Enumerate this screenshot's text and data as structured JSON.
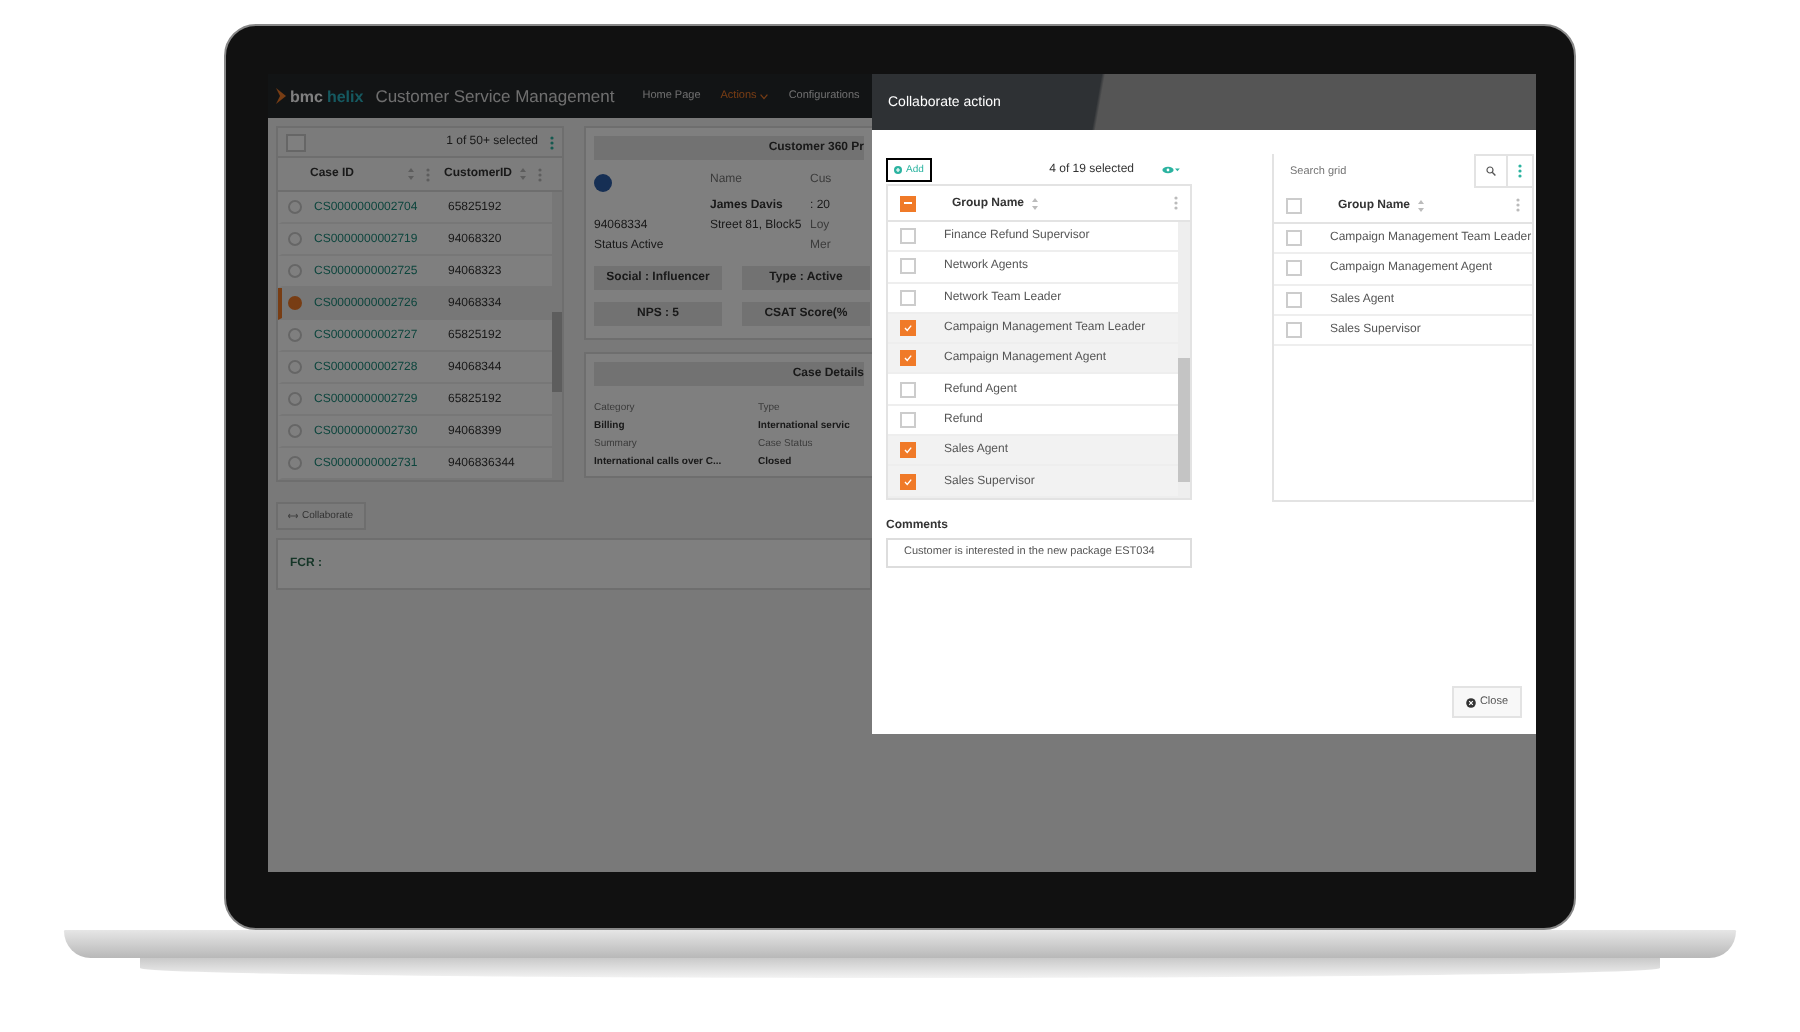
{
  "app": {
    "logo": {
      "brand": "bmc",
      "product": "helix"
    },
    "title": "Customer Service Management",
    "nav": [
      {
        "label": "Home Page",
        "selected": false,
        "has_menu": false
      },
      {
        "label": "Actions",
        "selected": true,
        "has_menu": true
      },
      {
        "label": "Configurations",
        "selected": false,
        "has_menu": false
      }
    ]
  },
  "cases": {
    "selection": "1 of 50+ selected",
    "columns": [
      "Case ID",
      "CustomerID"
    ],
    "rows": [
      {
        "case_id": "CS0000000002704",
        "customer_id": "65825192",
        "selected": false
      },
      {
        "case_id": "CS0000000002719",
        "customer_id": "94068320",
        "selected": false
      },
      {
        "case_id": "CS0000000002725",
        "customer_id": "94068323",
        "selected": false
      },
      {
        "case_id": "CS0000000002726",
        "customer_id": "94068334",
        "selected": true
      },
      {
        "case_id": "CS0000000002727",
        "customer_id": "65825192",
        "selected": false
      },
      {
        "case_id": "CS0000000002728",
        "customer_id": "94068344",
        "selected": false
      },
      {
        "case_id": "CS0000000002729",
        "customer_id": "65825192",
        "selected": false
      },
      {
        "case_id": "CS0000000002730",
        "customer_id": "94068399",
        "selected": false
      },
      {
        "case_id": "CS0000000002731",
        "customer_id": "9406836344",
        "selected": false
      }
    ],
    "button": "Collaborate"
  },
  "customer": {
    "title": "Customer 360 Pr",
    "name_label": "Name",
    "name": "James Davis",
    "id": "94068334",
    "address": "Street 81, Block5",
    "status": "Status  Active",
    "column_3_label": "Cus",
    "column_3_value": ": 20",
    "column_3_extra": "Loy",
    "column_3_extra_2": "Mer",
    "tags": [
      "Social : Influencer",
      "Type : Active",
      "NPS : 5",
      "CSAT Score(%"
    ]
  },
  "case_details": {
    "title": "Case Details",
    "fields": [
      {
        "label": "Category",
        "value": "Billing"
      },
      {
        "label": "Type",
        "value": "International servic"
      },
      {
        "label": "Summary",
        "value": "International calls over C..."
      },
      {
        "label": "Case Status",
        "value": "Closed"
      }
    ]
  },
  "fcr": {
    "label": "FCR :"
  },
  "dialog": {
    "title": "Collaborate action",
    "left_grid": {
      "add": "Add",
      "selection": "4 of 19 selected",
      "column": "Group Name",
      "header_checkbox": {
        "indeterminate": true
      },
      "rows": [
        {
          "name": "Finance Refund Supervisor",
          "checked": false
        },
        {
          "name": "Network Agents",
          "checked": false
        },
        {
          "name": "Network Team Leader",
          "checked": false
        },
        {
          "name": "Campaign Management Team Leader",
          "checked": true
        },
        {
          "name": "Campaign Management Agent",
          "checked": true
        },
        {
          "name": "Refund Agent",
          "checked": false
        },
        {
          "name": "Refund",
          "checked": false
        },
        {
          "name": "Sales Agent",
          "checked": true
        },
        {
          "name": "Sales Supervisor",
          "checked": true
        }
      ]
    },
    "comments": {
      "label": "Comments",
      "value": "Customer is interested in the new package EST034"
    },
    "right_grid": {
      "search": {
        "placeholder": "Search grid"
      },
      "column": "Group Name",
      "header_checkbox": {
        "indeterminate": false
      },
      "rows": [
        {
          "name": "Campaign Management Team Leader",
          "checked": false
        },
        {
          "name": "Campaign Management Agent",
          "checked": false
        },
        {
          "name": "Sales Agent",
          "checked": false
        },
        {
          "name": "Sales Supervisor",
          "checked": false
        }
      ]
    },
    "close": "Close"
  }
}
